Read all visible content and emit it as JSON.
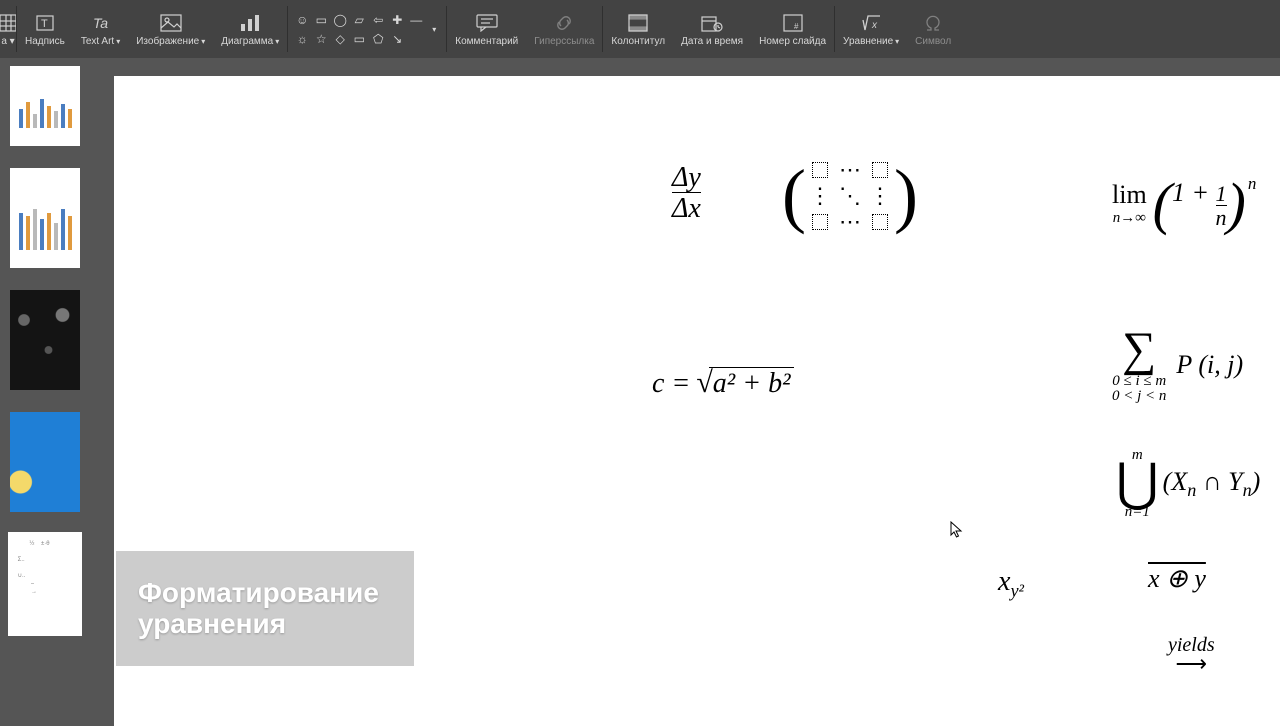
{
  "toolbar": {
    "cutoff_hint": "а ▾",
    "text_box": "Надпись",
    "text_art": "Text Art",
    "image": "Изображение",
    "chart": "Диаграмма",
    "comment": "Комментарий",
    "hyperlink": "Гиперссылка",
    "header_footer": "Колонтитул",
    "date_time": "Дата и время",
    "slide_number": "Номер слайда",
    "equation": "Уравнение",
    "symbol": "Символ"
  },
  "shapes": [
    "☺",
    "▭",
    "◯",
    "▱",
    "⇦",
    "✚",
    "—",
    "☼",
    "☆",
    "◇",
    "▭",
    "⬠",
    "↘"
  ],
  "equations": {
    "frac_num": "Δy",
    "frac_den": "Δx",
    "matrix_dots_h": "⋯",
    "matrix_dots_v": "⋮",
    "matrix_dots_d": "⋱",
    "lim_text": "lim",
    "lim_sub": "n→∞",
    "lim_one": "1 + ",
    "lim_frac_num": "1",
    "lim_frac_den": "n",
    "lim_exp": "n",
    "pyth_lhs": "c =",
    "pyth_body": "a² + b²",
    "sigma_sub1": "0 ≤ i ≤ m",
    "sigma_sub2": "0 < j < n",
    "sigma_body": "P (i, j)",
    "cup_sup": "m",
    "cup_sub": "n=1",
    "cup_body_x": "X",
    "cup_body_y": "Y",
    "cup_body_n": "n",
    "x_sub": "x",
    "x_sub_expr": "y²",
    "bar_body": "x ⊕ y",
    "yields": "yields",
    "arrow": "⟶"
  },
  "toast_text": "Форматирование уравнения"
}
